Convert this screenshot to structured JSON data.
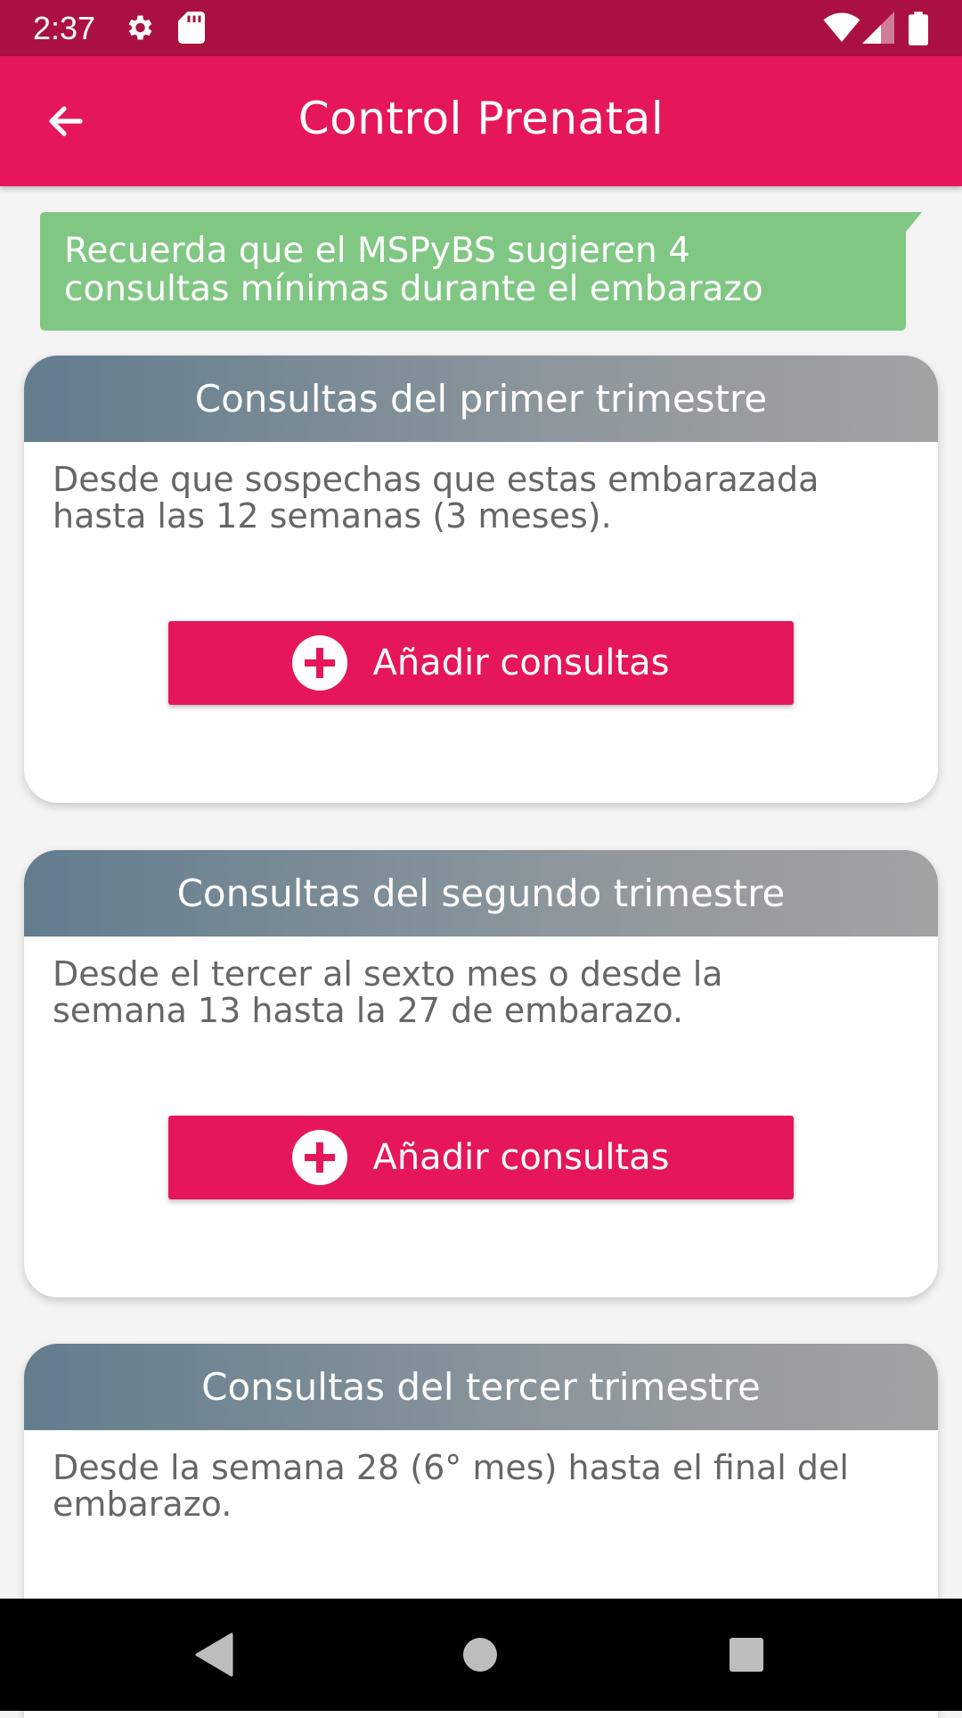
{
  "status_bar": {
    "time": "2:37",
    "icons": [
      "gear-icon",
      "sd-card-icon",
      "wifi-icon",
      "signal-icon",
      "battery-icon"
    ]
  },
  "app_bar": {
    "title": "Control Prenatal",
    "back_icon": "arrow-back-icon"
  },
  "reminder": {
    "line1": "Recuerda que el MSPyBS sugieren 4",
    "line2": "consultas mínimas durante el embarazo"
  },
  "cards": [
    {
      "title": "Consultas del primer trimestre",
      "desc_line1": "Desde que sospechas que estas embarazada",
      "desc_line2": "hasta las 12 semanas (3 meses).",
      "button_label": "Añadir consultas"
    },
    {
      "title": "Consultas del segundo trimestre",
      "desc_line1": "Desde el tercer al sexto mes o desde la",
      "desc_line2": "semana 13 hasta la 27 de embarazo.",
      "button_label": "Añadir consultas"
    },
    {
      "title": "Consultas del tercer trimestre",
      "desc_line1": "Desde la semana 28 (6° mes) hasta el final del",
      "desc_line2": "embarazo."
    }
  ],
  "nav_bar": {
    "icons": [
      "nav-back-icon",
      "nav-home-icon",
      "nav-recents-icon"
    ]
  },
  "colors": {
    "status_bar": "#ab1140",
    "app_bar": "#e5175a",
    "reminder": "#81c784",
    "header_start": "#637d8e",
    "header_end": "#a2a2a2",
    "button": "#e5175a"
  }
}
